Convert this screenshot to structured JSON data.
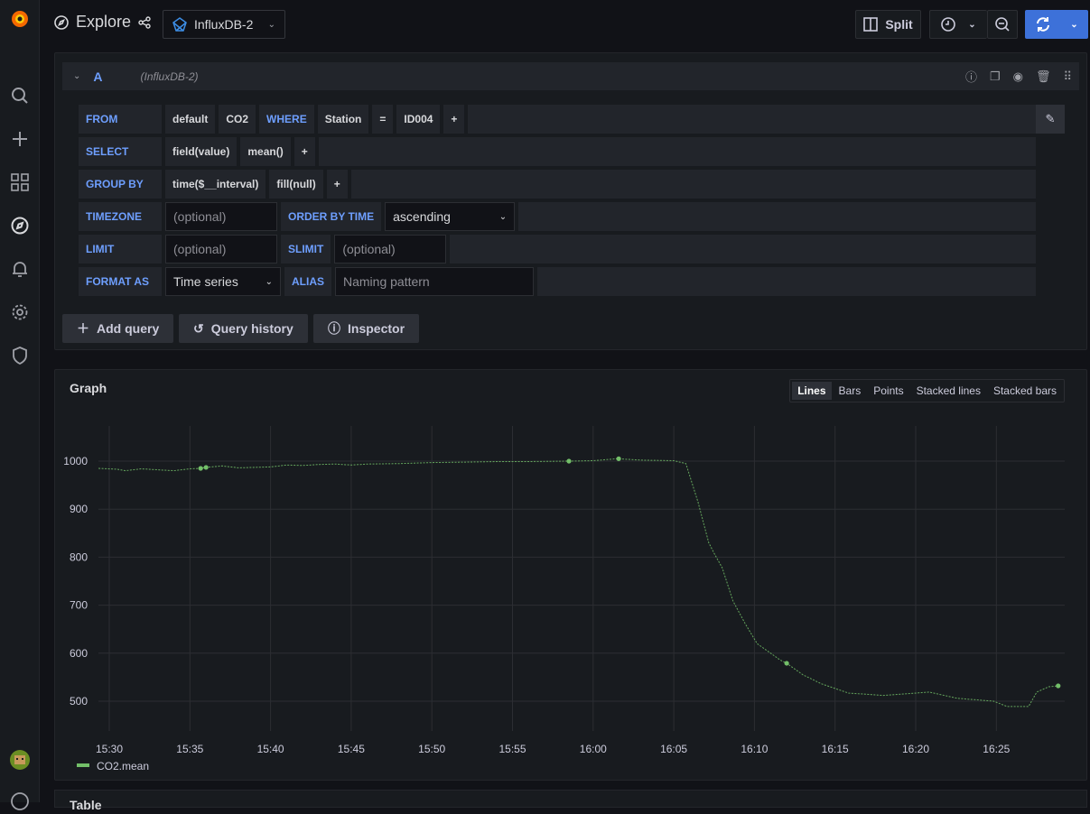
{
  "header": {
    "title": "Explore",
    "datasource": "InfluxDB-2",
    "split_label": "Split"
  },
  "query": {
    "ref_id": "A",
    "datasource_hint": "(InfluxDB-2)",
    "from": {
      "label": "FROM",
      "policy": "default",
      "measurement": "CO2",
      "where_label": "WHERE",
      "tag": "Station",
      "op": "=",
      "value": "ID004",
      "add": "+"
    },
    "select": {
      "label": "SELECT",
      "field": "field(value)",
      "fn": "mean()",
      "add": "+"
    },
    "group_by": {
      "label": "GROUP BY",
      "time": "time($__interval)",
      "fill": "fill(null)",
      "add": "+"
    },
    "timezone": {
      "label": "TIMEZONE",
      "placeholder": "(optional)",
      "order_label": "ORDER BY TIME",
      "order_value": "ascending"
    },
    "limit": {
      "label": "LIMIT",
      "placeholder": "(optional)",
      "slimit_label": "SLIMIT",
      "slimit_placeholder": "(optional)"
    },
    "format": {
      "label": "FORMAT AS",
      "value": "Time series",
      "alias_label": "ALIAS",
      "alias_placeholder": "Naming pattern"
    }
  },
  "actions": {
    "add_query": "Add query",
    "history": "Query history",
    "inspector": "Inspector"
  },
  "graph": {
    "title": "Graph",
    "modes": [
      "Lines",
      "Bars",
      "Points",
      "Stacked lines",
      "Stacked bars"
    ],
    "active_mode": "Lines"
  },
  "table_panel": {
    "title": "Table"
  },
  "chart_data": {
    "type": "line",
    "ylim": [
      420,
      1060
    ],
    "yticks": [
      500,
      600,
      700,
      800,
      900,
      1000
    ],
    "xticks": [
      "15:30",
      "15:35",
      "15:40",
      "15:45",
      "15:50",
      "15:55",
      "16:00",
      "16:05",
      "16:10",
      "16:15",
      "16:20",
      "16:25"
    ],
    "grid": true,
    "legend_placement": "bottom-left",
    "series": [
      {
        "name": "CO2.mean",
        "color": "#73bf69",
        "x": [
          "15:29:20",
          "15:30:30",
          "15:31:00",
          "15:32:00",
          "15:33:00",
          "15:34:00",
          "15:35:00",
          "15:35:40",
          "15:36:00",
          "15:37:00",
          "15:38:00",
          "15:39:00",
          "15:40:00",
          "15:41:00",
          "15:42:00",
          "15:43:00",
          "15:44:00",
          "15:45:00",
          "15:46:00",
          "15:48:00",
          "15:50:00",
          "15:52:00",
          "15:54:00",
          "15:56:00",
          "15:58:30",
          "16:00:00",
          "16:01:30",
          "16:03:00",
          "16:05:00",
          "16:05:45",
          "16:06:30",
          "16:07:10",
          "16:07:30",
          "16:08:00",
          "16:08:40",
          "16:09:25",
          "16:10:10",
          "16:11:35",
          "16:12:00",
          "16:13:00",
          "16:14:10",
          "16:15:50",
          "16:18:00",
          "16:20:50",
          "16:22:35",
          "16:24:50",
          "16:25:40",
          "16:27:00",
          "16:27:30",
          "16:28:15",
          "16:28:50"
        ],
        "y": [
          985,
          983,
          980,
          984,
          982,
          980,
          984,
          985,
          987,
          990,
          986,
          987,
          988,
          992,
          991,
          993,
          994,
          992,
          994,
          995,
          997,
          998,
          999,
          999,
          1000,
          1001,
          1005,
          1002,
          1001,
          995,
          915,
          830,
          808,
          778,
          709,
          662,
          620,
          586,
          579,
          555,
          536,
          517,
          512,
          519,
          506,
          500,
          489,
          489,
          519,
          530,
          532
        ]
      }
    ],
    "highlighted_points": [
      [
        "15:35:40",
        985
      ],
      [
        "15:36:00",
        987
      ],
      [
        "15:58:30",
        1000
      ],
      [
        "16:01:35",
        1005
      ],
      [
        "16:12:00",
        579
      ],
      [
        "16:28:50",
        532
      ]
    ]
  }
}
